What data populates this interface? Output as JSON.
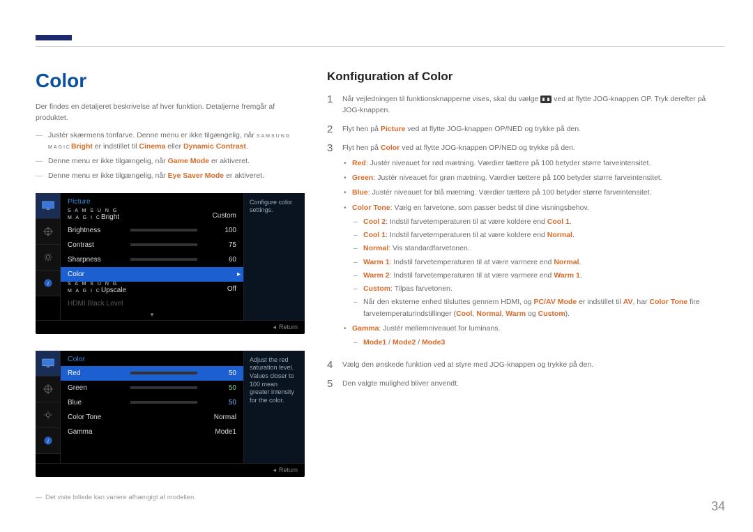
{
  "page_number": "34",
  "left": {
    "heading": "Color",
    "intro": "Der findes en detaljeret beskrivelse af hver funktion. Detaljerne fremgår af produktet.",
    "notes": {
      "n1_a": "Justér skærmens tonfarve. Denne menu er ikke tilgængelig, når ",
      "n1_brand1": "SAMSUNG",
      "n1_brand2": "MAGIC",
      "n1_b": "Bright",
      "n1_c": " er indstillet til ",
      "n1_d": "Cinema",
      "n1_e": " eller ",
      "n1_f": "Dynamic Contrast",
      "n2_a": "Denne menu er ikke tilgængelig, når ",
      "n2_b": "Game Mode",
      "n2_c": " er aktiveret.",
      "n3_a": "Denne menu er ikke tilgængelig, når ",
      "n3_b": "Eye Saver Mode",
      "n3_c": " er aktiveret."
    },
    "osd1": {
      "title": "Picture",
      "desc": "Configure color settings.",
      "magic_bright_brand1": "S A M S U N G",
      "magic_bright_brand2": "M A G I C",
      "magic_bright_suffix": "Bright",
      "magic_bright_val": "Custom",
      "brightness": "Brightness",
      "brightness_val": "100",
      "contrast": "Contrast",
      "contrast_val": "75",
      "sharpness": "Sharpness",
      "sharpness_val": "60",
      "color": "Color",
      "upscale_brand1": "S A M S U N G",
      "upscale_brand2": "M A G I C",
      "upscale_suffix": "Upscale",
      "upscale_val": "Off",
      "hdmi": "HDMI Black Level",
      "return": "Return"
    },
    "osd2": {
      "title": "Color",
      "desc": "Adjust the red saturation level. Values closer to 100 mean greater intensity for the color.",
      "red": "Red",
      "red_val": "50",
      "green": "Green",
      "green_val": "50",
      "blue": "Blue",
      "blue_val": "50",
      "colortone": "Color Tone",
      "colortone_val": "Normal",
      "gamma": "Gamma",
      "gamma_val": "Mode1",
      "return": "Return"
    },
    "footnote": "Det viste billede kan variere afhængigt af modellen."
  },
  "right": {
    "heading": "Konfiguration af Color",
    "s1_a": "Når vejledningen til funktionsknapperne vises, skal du vælge ",
    "s1_b": " ved at flytte JOG-knappen OP. Tryk derefter på JOG-knappen.",
    "s2_a": "Flyt hen på ",
    "s2_b": "Picture",
    "s2_c": " ved at flytte JOG-knappen OP/NED og trykke på den.",
    "s3_a": "Flyt hen på ",
    "s3_b": "Color",
    "s3_c": " ved at flytte JOG-knappen OP/NED og trykke på den.",
    "bullets": {
      "red_a": "Red",
      "red_b": ": Justér niveauet for rød mætning. Værdier tættere på 100 betyder større farveintensitet.",
      "green_a": "Green",
      "green_b": ": Justér niveauet for grøn mætning. Værdier tættere på 100 betyder større farveintensitet.",
      "blue_a": "Blue",
      "blue_b": ": Justér niveauet for blå mætning. Værdier tættere på 100 betyder større farveintensitet.",
      "ct_a": "Color Tone",
      "ct_b": ": Vælg en farvetone, som passer bedst til dine visningsbehov.",
      "ct_cool2_a": "Cool 2",
      "ct_cool2_b": ": Indstil farvetemperaturen til at være koldere end ",
      "ct_cool2_c": "Cool 1",
      "ct_cool1_a": "Cool 1",
      "ct_cool1_b": ": Indstil farvetemperaturen til at være koldere end ",
      "ct_cool1_c": "Normal",
      "ct_norm_a": "Normal",
      "ct_norm_b": ": Vis standardfarvetonen.",
      "ct_warm1_a": "Warm 1",
      "ct_warm1_b": ": Indstil farvetemperaturen til at være varmere end ",
      "ct_warm1_c": "Normal",
      "ct_warm2_a": "Warm 2",
      "ct_warm2_b": ": Indstil farvetemperaturen til at være varmere end ",
      "ct_warm2_c": "Warm 1",
      "ct_cust_a": "Custom",
      "ct_cust_b": ": Tilpas farvetonen.",
      "ct_note_a": "Når den eksterne enhed tilsluttes gennem HDMI, og ",
      "ct_note_b": "PC/AV Mode",
      "ct_note_c": " er indstillet til ",
      "ct_note_d": "AV",
      "ct_note_e": ", har ",
      "ct_note_f": "Color Tone",
      "ct_note_g": " fire farvetemperaturindstillinger (",
      "ct_note_h": "Cool",
      "ct_note_i": ", ",
      "ct_note_j": "Normal",
      "ct_note_k": ", ",
      "ct_note_l": "Warm",
      "ct_note_m": " og ",
      "ct_note_n": "Custom",
      "ct_note_o": ").",
      "gamma_a": "Gamma",
      "gamma_b": ": Justér mellemniveauet for luminans.",
      "gamma_modes_a": "Mode1",
      "gamma_modes_b": " / ",
      "gamma_modes_c": "Mode2",
      "gamma_modes_d": " / ",
      "gamma_modes_e": "Mode3"
    },
    "s4": "Vælg den ønskede funktion ved at styre med JOG-knappen og trykke på den.",
    "s5": "Den valgte mulighed bliver anvendt."
  }
}
